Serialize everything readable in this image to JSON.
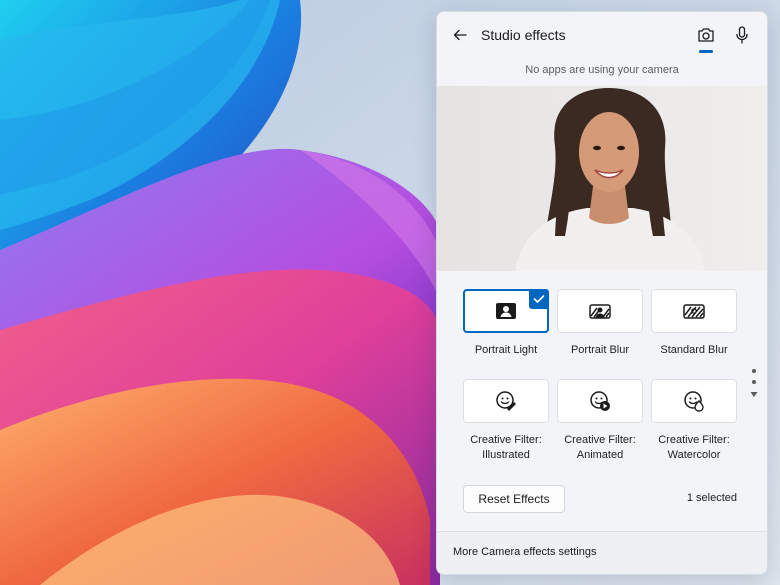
{
  "panel": {
    "title": "Studio effects",
    "status": "No apps are using your camera",
    "tabs": [
      {
        "icon": "camera-icon",
        "active": true
      },
      {
        "icon": "microphone-icon",
        "active": false
      }
    ]
  },
  "effects": [
    {
      "label": "Portrait Light",
      "icon": "portrait-light-icon",
      "selected": true
    },
    {
      "label": "Portrait Blur",
      "icon": "portrait-blur-icon",
      "selected": false
    },
    {
      "label": "Standard Blur",
      "icon": "standard-blur-icon",
      "selected": false
    },
    {
      "label_line1": "Creative Filter:",
      "label_line2": "Illustrated",
      "icon": "illustrated-filter-icon",
      "selected": false
    },
    {
      "label_line1": "Creative Filter:",
      "label_line2": "Animated",
      "icon": "animated-filter-icon",
      "selected": false
    },
    {
      "label_line1": "Creative Filter:",
      "label_line2": "Watercolor",
      "icon": "watercolor-filter-icon",
      "selected": false
    }
  ],
  "actions": {
    "reset_label": "Reset Effects",
    "selected_count": "1 selected"
  },
  "footer": {
    "link": "More Camera effects settings"
  },
  "colors": {
    "accent": "#0067c0",
    "panel_bg": "#f3f4f7"
  }
}
